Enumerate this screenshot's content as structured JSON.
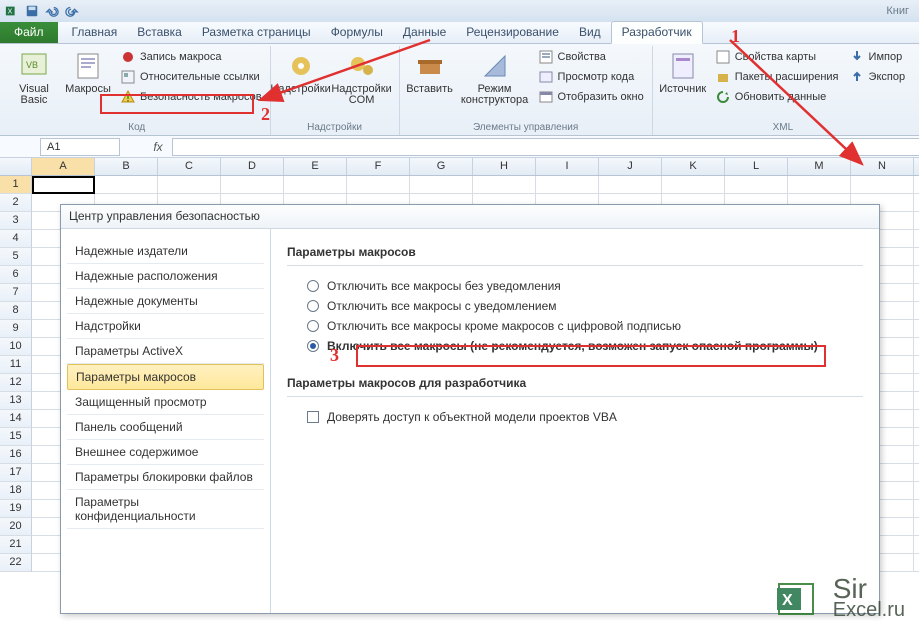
{
  "app": {
    "document_name": "Книг"
  },
  "tabs": {
    "file": "Файл",
    "items": [
      "Главная",
      "Вставка",
      "Разметка страницы",
      "Формулы",
      "Данные",
      "Рецензирование",
      "Вид",
      "Разработчик"
    ],
    "active_index": 7
  },
  "ribbon": {
    "code": {
      "title": "Код",
      "visual_basic": "Visual\nBasic",
      "macros": "Макросы",
      "record_macro": "Запись макроса",
      "relative_refs": "Относительные ссылки",
      "macro_security": "Безопасность макросов"
    },
    "addins": {
      "title": "Надстройки",
      "addins": "Надстройки",
      "com_addins": "Надстройки\nCOM"
    },
    "controls": {
      "title": "Элементы управления",
      "insert": "Вставить",
      "design_mode": "Режим\nконструктора",
      "properties": "Свойства",
      "view_code": "Просмотр кода",
      "run_dialog": "Отобразить окно"
    },
    "xml": {
      "title": "XML",
      "source": "Источник",
      "map_properties": "Свойства карты",
      "expansion_packs": "Пакеты расширения",
      "refresh_data": "Обновить данные",
      "import": "Импор",
      "export": "Экспор"
    }
  },
  "namebox": {
    "value": "A1"
  },
  "sheet": {
    "cols": [
      "A",
      "B",
      "C",
      "D",
      "E",
      "F",
      "G",
      "H",
      "I",
      "J",
      "K",
      "L",
      "M",
      "N"
    ],
    "rows": [
      "1",
      "2",
      "3",
      "4",
      "5",
      "6",
      "7",
      "8",
      "9",
      "10",
      "11",
      "12",
      "13",
      "14",
      "15",
      "16",
      "17",
      "18",
      "19",
      "20",
      "21",
      "22"
    ]
  },
  "dialog": {
    "title": "Центр управления безопасностью",
    "nav": [
      "Надежные издатели",
      "Надежные расположения",
      "Надежные документы",
      "Надстройки",
      "Параметры ActiveX",
      "Параметры макросов",
      "Защищенный просмотр",
      "Панель сообщений",
      "Внешнее содержимое",
      "Параметры блокировки файлов",
      "Параметры конфиденциальности"
    ],
    "nav_selected": 5,
    "section1_title": "Параметры макросов",
    "radios": [
      "Отключить все макросы без уведомления",
      "Отключить все макросы с уведомлением",
      "Отключить все макросы кроме макросов с цифровой подписью",
      "Включить все макросы (не рекомендуется, возможен запуск опасной программы)"
    ],
    "radio_selected": 3,
    "section2_title": "Параметры макросов для разработчика",
    "checkbox_label": "Доверять доступ к объектной модели проектов VBA"
  },
  "annotations": {
    "n1": "1",
    "n2": "2",
    "n3": "3"
  },
  "watermark": {
    "line1": "Sir",
    "line2": "Excel.ru"
  }
}
